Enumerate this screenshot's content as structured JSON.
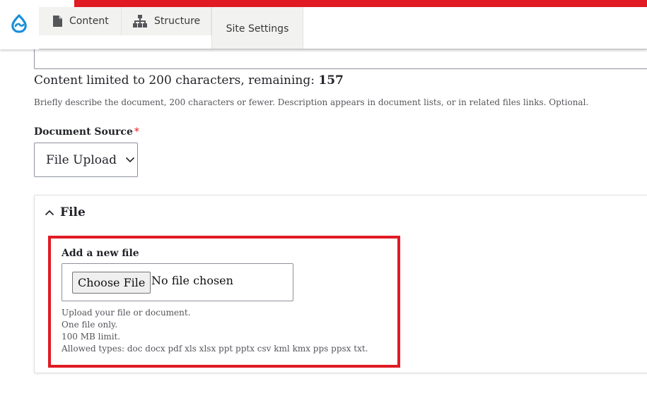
{
  "toolbar": {
    "logo_icon": "drupal-drop-icon",
    "accent_color": "#e01b24",
    "tabs": [
      {
        "label": "Content",
        "icon": "document-icon"
      },
      {
        "label": "Structure",
        "icon": "sitemap-icon"
      },
      {
        "label": "Site Settings"
      }
    ]
  },
  "form": {
    "counter_prefix": "Content limited to 200 characters, remaining: ",
    "counter_remaining": "157",
    "description_help": "Briefly describe the document, 200 characters or fewer. Description appears in document lists, or in related files links. Optional.",
    "document_source": {
      "label": "Document Source",
      "required_marker": "*",
      "selected_value": "File Upload"
    },
    "file_section": {
      "title": "File",
      "add_label": "Add a new file",
      "choose_button": "Choose File",
      "no_file_text": "No file chosen",
      "help_lines": [
        "Upload your file or document.",
        "One file only.",
        "100 MB limit.",
        "Allowed types: doc docx pdf xls xlsx ppt pptx csv kml kmx pps ppsx txt."
      ]
    }
  }
}
